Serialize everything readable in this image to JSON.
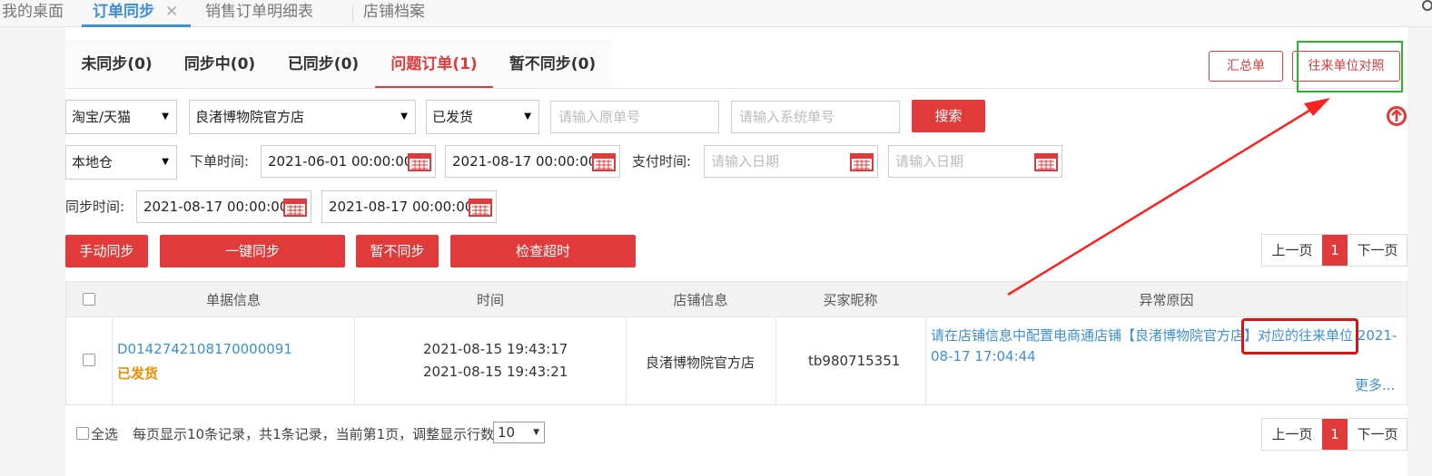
{
  "top_tabs": [
    {
      "label": "我的桌面"
    },
    {
      "label": "订单同步",
      "close": "✕"
    },
    {
      "label": "销售订单明细表"
    },
    {
      "label": "店铺档案"
    }
  ],
  "status_tabs": [
    {
      "label": "未同步(0)"
    },
    {
      "label": "同步中(0)"
    },
    {
      "label": "已同步(0)"
    },
    {
      "label": "问题订单(1)"
    },
    {
      "label": "暂不同步(0)"
    }
  ],
  "header_buttons": {
    "summary": "汇总单",
    "partner_map": "往来单位对照"
  },
  "filters": {
    "platform": "淘宝/天猫",
    "shop": "良渚博物院官方店",
    "ship_status": "已发货",
    "orig_no_placeholder": "请输入原单号",
    "sys_no_placeholder": "请输入系统单号",
    "search": "搜索",
    "warehouse": "本地仓",
    "order_time_label": "下单时间:",
    "order_time_from": "2021-06-01 00:00:00",
    "order_time_to": "2021-08-17 00:00:00",
    "pay_time_label": "支付时间:",
    "pay_from_placeholder": "请输入日期",
    "pay_to_placeholder": "请输入日期",
    "sync_time_label": "同步时间:",
    "sync_from": "2021-08-17 00:00:00",
    "sync_to": "2021-08-17 00:00:00"
  },
  "actions": {
    "manual_sync": "手动同步",
    "one_click_sync": "一键同步",
    "no_sync": "暂不同步",
    "check_timeout": "检查超时"
  },
  "pager": {
    "prev": "上一页",
    "current": "1",
    "next": "下一页"
  },
  "table": {
    "columns": [
      "单据信息",
      "时间",
      "店铺信息",
      "买家昵称",
      "异常原因"
    ],
    "rows": [
      {
        "order_no": "D0142742108170000091",
        "status": "已发货",
        "time1": "2021-08-15 19:43:17",
        "time2": "2021-08-15 19:43:21",
        "shop": "良渚博物院官方店",
        "buyer": "tb980715351",
        "reason_line1": "请在店铺信息中配置电商通店铺【良渚博物院官方店】对应的往来单位 2021-",
        "reason_line2": "08-17 17:04:44",
        "more": "更多..."
      }
    ]
  },
  "footer": {
    "select_all": "全选",
    "info": "每页显示10条记录，共1条记录，当前第1页，调整显示行数",
    "rows_per_page": "10"
  },
  "colors": {
    "accent_red": "#e03a3a",
    "link_blue": "#3d8fd6",
    "highlight_green": "#2bb52b"
  }
}
